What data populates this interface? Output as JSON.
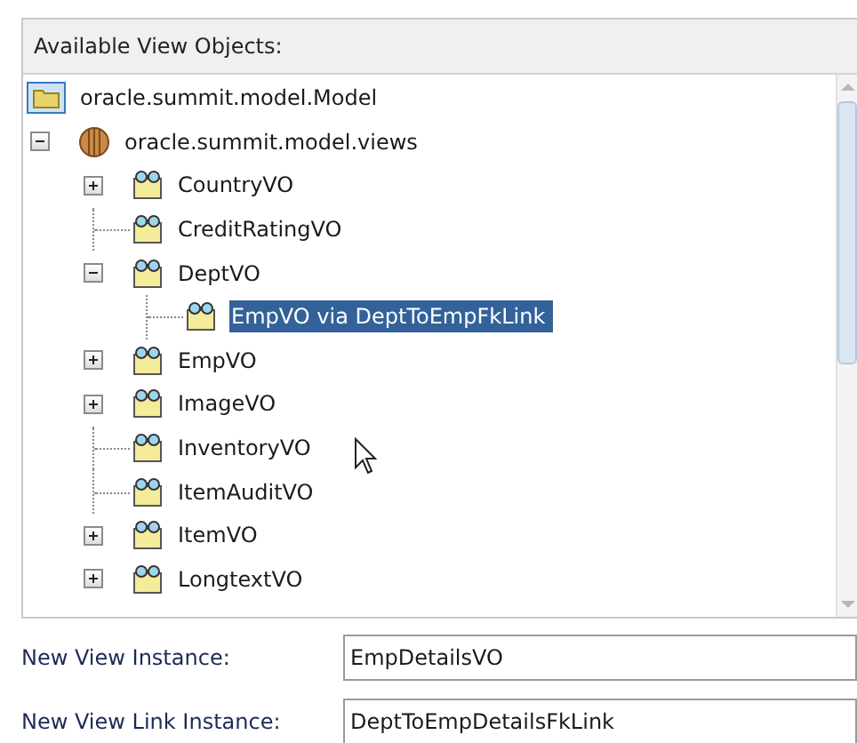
{
  "panel": {
    "title": "Available View Objects:"
  },
  "tree": [
    {
      "label": "oracle.summit.model.Model",
      "kind": "folder",
      "selected": false,
      "children": [
        {
          "label": "oracle.summit.model.views",
          "kind": "package",
          "selected": false,
          "expanded": true,
          "children": [
            {
              "label": "CountryVO",
              "kind": "view",
              "selected": false,
              "expanded": false
            },
            {
              "label": "CreditRatingVO",
              "kind": "view",
              "selected": false
            },
            {
              "label": "DeptVO",
              "kind": "view",
              "selected": false,
              "expanded": true,
              "children": [
                {
                  "label": "EmpVO via DeptToEmpFkLink",
                  "kind": "view",
                  "selected": true
                }
              ]
            },
            {
              "label": "EmpVO",
              "kind": "view",
              "selected": false,
              "expanded": false
            },
            {
              "label": "ImageVO",
              "kind": "view",
              "selected": false,
              "expanded": false
            },
            {
              "label": "InventoryVO",
              "kind": "view",
              "selected": false
            },
            {
              "label": "ItemAuditVO",
              "kind": "view",
              "selected": false
            },
            {
              "label": "ItemVO",
              "kind": "view",
              "selected": false,
              "expanded": false
            },
            {
              "label": "LongtextVO",
              "kind": "view",
              "selected": false,
              "expanded": false
            }
          ]
        }
      ]
    }
  ],
  "fields": [
    {
      "label": "New View Instance:",
      "value": "EmpDetailsVO"
    },
    {
      "label": "New View Link Instance:",
      "value": "DeptToEmpDetailsFkLink"
    }
  ]
}
